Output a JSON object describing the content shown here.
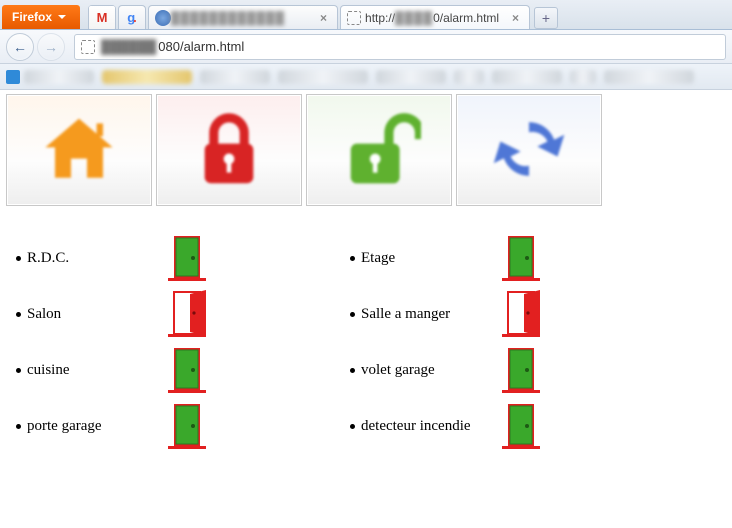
{
  "browser": {
    "name": "Firefox",
    "tabs": [
      {
        "type": "icon",
        "icon": "gmail"
      },
      {
        "type": "icon",
        "icon": "google"
      },
      {
        "type": "page",
        "title_blurred": true,
        "active": false
      },
      {
        "type": "page",
        "title_prefix": "http://",
        "title_suffix": "0/alarm.html",
        "title_blurred_mid": true,
        "active": true,
        "show_page_icon": true
      }
    ],
    "url_visible_suffix": "080/alarm.html",
    "url_blurred_prefix": true
  },
  "toolbar_buttons": [
    {
      "id": "home",
      "icon": "home-icon",
      "color": "#f59a1e",
      "bg": "#fff6ec"
    },
    {
      "id": "lock",
      "icon": "lock-closed-icon",
      "color": "#d82424",
      "bg": "#fdeeee"
    },
    {
      "id": "unlock",
      "icon": "lock-open-icon",
      "color": "#5fb12f",
      "bg": "#f1f8ed"
    },
    {
      "id": "refresh",
      "icon": "refresh-icon",
      "color": "#4f77d6",
      "bg": "#f0f4fc"
    }
  ],
  "sensors": {
    "left": [
      {
        "label": "R.D.C.",
        "state": "closed"
      },
      {
        "label": "Salon",
        "state": "open"
      },
      {
        "label": "cuisine",
        "state": "closed"
      },
      {
        "label": "porte garage",
        "state": "closed"
      }
    ],
    "right": [
      {
        "label": "Etage",
        "state": "closed"
      },
      {
        "label": "Salle a manger",
        "state": "open"
      },
      {
        "label": "volet garage",
        "state": "closed"
      },
      {
        "label": "detecteur incendie",
        "state": "closed"
      }
    ]
  },
  "door_colors": {
    "closed": "#3aa82b",
    "open": "#e22020",
    "frame": "#e22020"
  }
}
